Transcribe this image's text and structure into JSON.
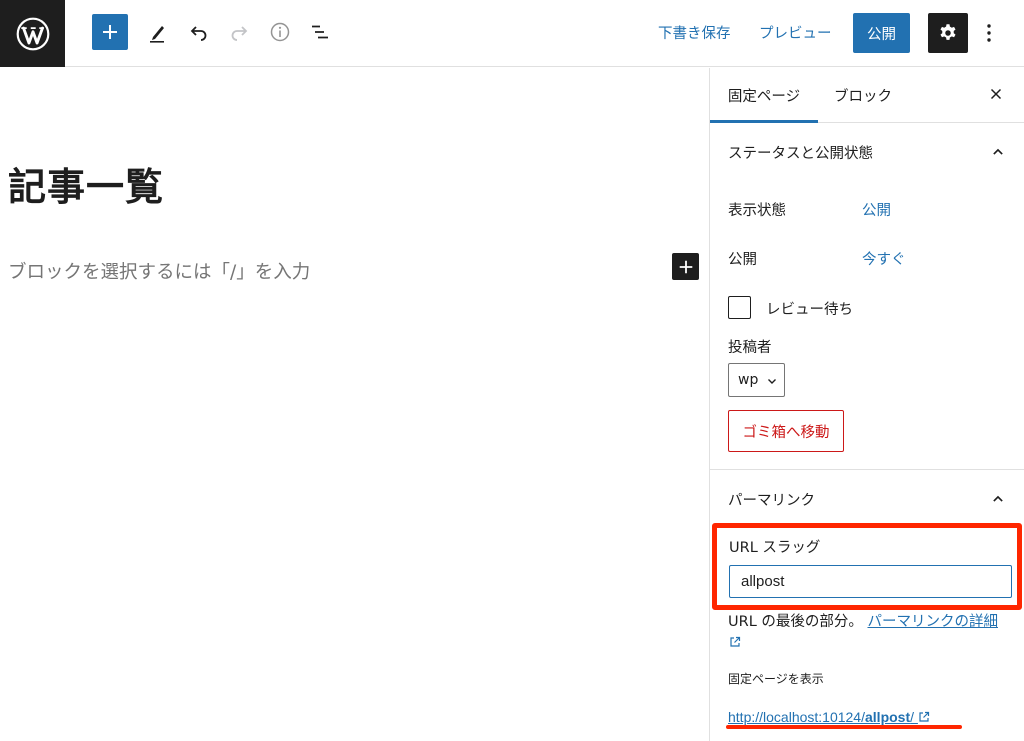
{
  "toolbar": {
    "logo_icon": "wordpress-logo-icon",
    "add_block_icon": "plus-icon",
    "tools_icon": "pencil-icon",
    "undo_icon": "undo-icon",
    "redo_icon": "redo-icon",
    "details_icon": "info-icon",
    "list_view_icon": "list-view-icon",
    "save_draft_label": "下書き保存",
    "preview_label": "プレビュー",
    "publish_label": "公開",
    "settings_icon": "gear-icon",
    "options_icon": "more-vertical-icon",
    "accent_color": "#2271b1"
  },
  "editor": {
    "title": "記事一覧",
    "block_placeholder": "ブロックを選択するには「/」を入力",
    "add_block_icon": "plus-icon"
  },
  "sidebar": {
    "tabs": [
      {
        "label": "固定ページ",
        "active": true
      },
      {
        "label": "ブロック",
        "active": false
      }
    ],
    "close_icon": "close-icon",
    "status_panel": {
      "title": "ステータスと公開状態",
      "visibility_label": "表示状態",
      "visibility_value": "公開",
      "publish_label": "公開",
      "publish_value": "今すぐ",
      "pending_review_label": "レビュー待ち",
      "pending_review_checked": false,
      "author_label": "投稿者",
      "author_value": "wp",
      "trash_label": "ゴミ箱へ移動",
      "danger_color": "#cc1818"
    },
    "permalink_panel": {
      "title": "パーマリンク",
      "slug_label": "URL スラッグ",
      "slug_value": "allpost",
      "help_text": "URL の最後の部分。",
      "help_link": "パーマリンクの詳細",
      "view_label": "固定ページを表示",
      "url_prefix": "http://localhost:10124/",
      "url_slug": "allpost",
      "url_suffix": "/",
      "highlight_color": "#ff2600"
    }
  }
}
